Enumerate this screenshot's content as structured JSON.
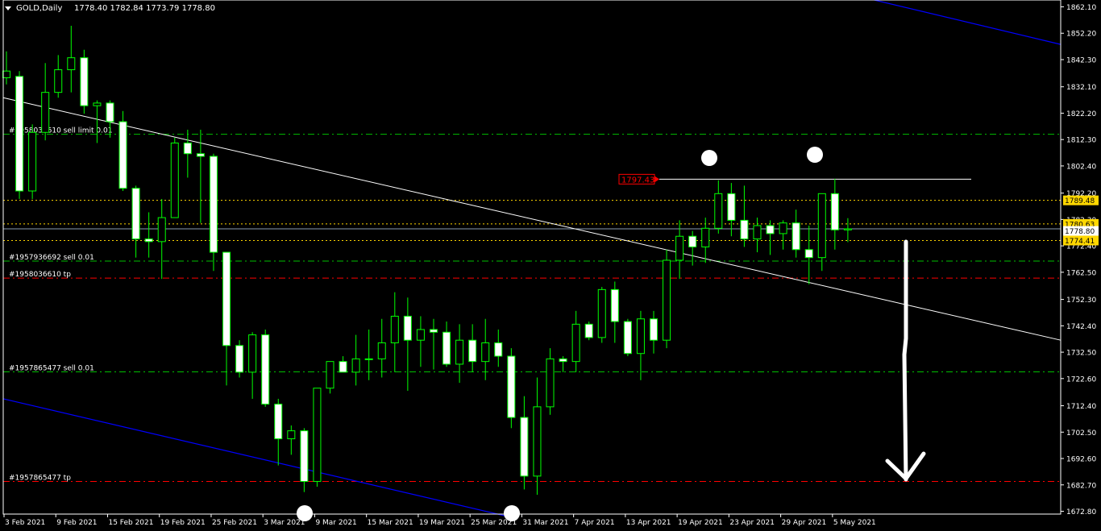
{
  "header": {
    "symbol": "GOLD,Daily",
    "ohlc": "1778.40 1782.84 1773.79 1778.80"
  },
  "colors": {
    "background": "#000000",
    "grid_frame": "#ffffff",
    "bull_body": "#000000",
    "bear_body": "#ffffff",
    "wick": "#00ff00",
    "order_line": "#00c000",
    "tp_line": "#ff0000",
    "level_line": "#ffd700",
    "trendline_white": "#ffffff",
    "channel_blue": "#0000ff",
    "bid_label": "#ffd700",
    "price_tag_red": "#ff0000"
  },
  "orders": [
    {
      "label": "#1958036610 sell limit 0.01",
      "price": 1814.3,
      "kind": "order"
    },
    {
      "label": "#1957936692 sell 0.01",
      "price": 1766.7,
      "kind": "order"
    },
    {
      "label": "#1958036610 tp",
      "price": 1760.3,
      "kind": "tp"
    },
    {
      "label": "#1957865477 sell 0.01",
      "price": 1725.1,
      "kind": "order"
    },
    {
      "label": "#1957865477 tp",
      "price": 1684.0,
      "kind": "tp"
    }
  ],
  "price_tags": {
    "resistance": "1797.43",
    "level_upper": "1789.48",
    "level_mid_a": "1780.63",
    "level_mid_b": "1778.80",
    "level_lower": "1774.41"
  },
  "chart_data": {
    "type": "candlestick",
    "symbol": "GOLD",
    "timeframe": "Daily",
    "y_axis": {
      "ylim": [
        1670.0,
        1865.0
      ],
      "tick_values": [
        1862.1,
        1852.2,
        1842.3,
        1832.1,
        1822.2,
        1812.3,
        1802.4,
        1792.2,
        1782.3,
        1772.4,
        1762.5,
        1752.3,
        1742.4,
        1732.5,
        1722.6,
        1712.4,
        1702.5,
        1692.6,
        1682.7,
        1672.8
      ],
      "tick_labels": [
        "1862.10",
        "1852.20",
        "1842.30",
        "1832.10",
        "1822.20",
        "1812.30",
        "1802.40",
        "1792.20",
        "1782.30",
        "1772.40",
        "1762.50",
        "1752.30",
        "1742.40",
        "1732.50",
        "1722.60",
        "1712.40",
        "1702.50",
        "1692.60",
        "1682.70",
        "1672.80"
      ]
    },
    "x_axis": {
      "date_labels": [
        {
          "label": "3 Feb 2021",
          "bar": 0
        },
        {
          "label": "9 Feb 2021",
          "bar": 4
        },
        {
          "label": "15 Feb 2021",
          "bar": 8
        },
        {
          "label": "19 Feb 2021",
          "bar": 12
        },
        {
          "label": "25 Feb 2021",
          "bar": 16
        },
        {
          "label": "3 Mar 2021",
          "bar": 20
        },
        {
          "label": "9 Mar 2021",
          "bar": 24
        },
        {
          "label": "15 Mar 2021",
          "bar": 28
        },
        {
          "label": "19 Mar 2021",
          "bar": 32
        },
        {
          "label": "25 Mar 2021",
          "bar": 36
        },
        {
          "label": "31 Mar 2021",
          "bar": 40
        },
        {
          "label": "7 Apr 2021",
          "bar": 44
        },
        {
          "label": "13 Apr 2021",
          "bar": 48
        },
        {
          "label": "19 Apr 2021",
          "bar": 52
        },
        {
          "label": "23 Apr 2021",
          "bar": 56
        },
        {
          "label": "29 Apr 2021",
          "bar": 60
        },
        {
          "label": "5 May 2021",
          "bar": 64
        }
      ]
    },
    "candles": [
      [
        1835.5,
        1845.4,
        1833.0,
        1838.0
      ],
      [
        1836.0,
        1838.0,
        1790.0,
        1793.0
      ],
      [
        1793.0,
        1818.0,
        1790.0,
        1815.0
      ],
      [
        1815.0,
        1841.0,
        1812.0,
        1830.0
      ],
      [
        1830.0,
        1844.0,
        1828.0,
        1838.5
      ],
      [
        1838.5,
        1855.0,
        1830.0,
        1843.0
      ],
      [
        1843.0,
        1846.0,
        1822.0,
        1825.0
      ],
      [
        1825.0,
        1827.0,
        1811.0,
        1826.0
      ],
      [
        1826.0,
        1827.0,
        1813.0,
        1819.0
      ],
      [
        1819.0,
        1823.0,
        1793.0,
        1794.0
      ],
      [
        1794.0,
        1795.0,
        1768.0,
        1775.0
      ],
      [
        1775.0,
        1785.0,
        1768.0,
        1774.0
      ],
      [
        1774.0,
        1790.0,
        1760.0,
        1783.0
      ],
      [
        1783.0,
        1813.0,
        1783.0,
        1811.0
      ],
      [
        1811.0,
        1816.0,
        1798.0,
        1807.0
      ],
      [
        1807.0,
        1816.0,
        1781.0,
        1806.0
      ],
      [
        1806.0,
        1807.0,
        1763.0,
        1770.0
      ],
      [
        1770.0,
        1770.0,
        1720.0,
        1735.0
      ],
      [
        1735.0,
        1737.0,
        1723.0,
        1725.0
      ],
      [
        1725.0,
        1740.0,
        1715.0,
        1739.0
      ],
      [
        1739.0,
        1741.0,
        1712.0,
        1713.0
      ],
      [
        1713.0,
        1715.0,
        1690.0,
        1700.0
      ],
      [
        1700.0,
        1705.0,
        1694.0,
        1703.0
      ],
      [
        1703.0,
        1704.0,
        1680.0,
        1684.0
      ],
      [
        1684.0,
        1712.0,
        1682.0,
        1719.0
      ],
      [
        1719.0,
        1729.0,
        1717.0,
        1729.0
      ],
      [
        1729.0,
        1731.0,
        1725.0,
        1725.0
      ],
      [
        1725.0,
        1739.0,
        1720.0,
        1730.0
      ],
      [
        1730.0,
        1741.0,
        1722.0,
        1730.0
      ],
      [
        1730.0,
        1745.0,
        1723.0,
        1736.0
      ],
      [
        1736.0,
        1755.0,
        1725.0,
        1746.0
      ],
      [
        1746.0,
        1753.0,
        1718.0,
        1737.0
      ],
      [
        1737.0,
        1746.0,
        1727.0,
        1741.0
      ],
      [
        1741.0,
        1745.0,
        1726.0,
        1740.0
      ],
      [
        1740.0,
        1744.0,
        1727.0,
        1728.0
      ],
      [
        1728.0,
        1743.0,
        1721.0,
        1737.0
      ],
      [
        1737.0,
        1743.0,
        1725.0,
        1729.0
      ],
      [
        1729.0,
        1745.0,
        1722.0,
        1736.0
      ],
      [
        1736.0,
        1741.0,
        1727.0,
        1731.0
      ],
      [
        1731.0,
        1734.0,
        1704.0,
        1708.0
      ],
      [
        1708.0,
        1716.0,
        1681.0,
        1686.0
      ],
      [
        1686.0,
        1723.0,
        1679.0,
        1712.0
      ],
      [
        1712.0,
        1734.0,
        1709.0,
        1730.0
      ],
      [
        1730.0,
        1731.0,
        1725.0,
        1729.0
      ],
      [
        1729.0,
        1748.0,
        1725.0,
        1743.0
      ],
      [
        1743.0,
        1744.0,
        1737.0,
        1738.0
      ],
      [
        1738.0,
        1757.0,
        1736.0,
        1756.0
      ],
      [
        1756.0,
        1759.0,
        1736.0,
        1744.0
      ],
      [
        1744.0,
        1745.0,
        1731.0,
        1732.0
      ],
      [
        1732.0,
        1748.0,
        1722.0,
        1745.0
      ],
      [
        1745.0,
        1748.0,
        1732.0,
        1737.0
      ],
      [
        1737.0,
        1771.0,
        1734.0,
        1767.0
      ],
      [
        1767.0,
        1782.0,
        1760.0,
        1776.0
      ],
      [
        1776.0,
        1778.0,
        1765.0,
        1772.0
      ],
      [
        1772.0,
        1783.0,
        1766.0,
        1779.0
      ],
      [
        1779.0,
        1797.0,
        1777.0,
        1792.0
      ],
      [
        1792.0,
        1796.0,
        1776.0,
        1782.0
      ],
      [
        1782.0,
        1795.0,
        1772.0,
        1775.0
      ],
      [
        1775.0,
        1783.0,
        1770.0,
        1780.0
      ],
      [
        1780.0,
        1782.0,
        1769.0,
        1777.0
      ],
      [
        1777.0,
        1782.0,
        1771.0,
        1781.0
      ],
      [
        1781.0,
        1786.0,
        1768.0,
        1771.0
      ],
      [
        1771.0,
        1780.0,
        1758.0,
        1768.0
      ],
      [
        1768.0,
        1788.0,
        1763.0,
        1792.0
      ],
      [
        1792.0,
        1797.6,
        1771.0,
        1778.4
      ],
      [
        1778.4,
        1782.8,
        1773.8,
        1778.8
      ]
    ]
  }
}
